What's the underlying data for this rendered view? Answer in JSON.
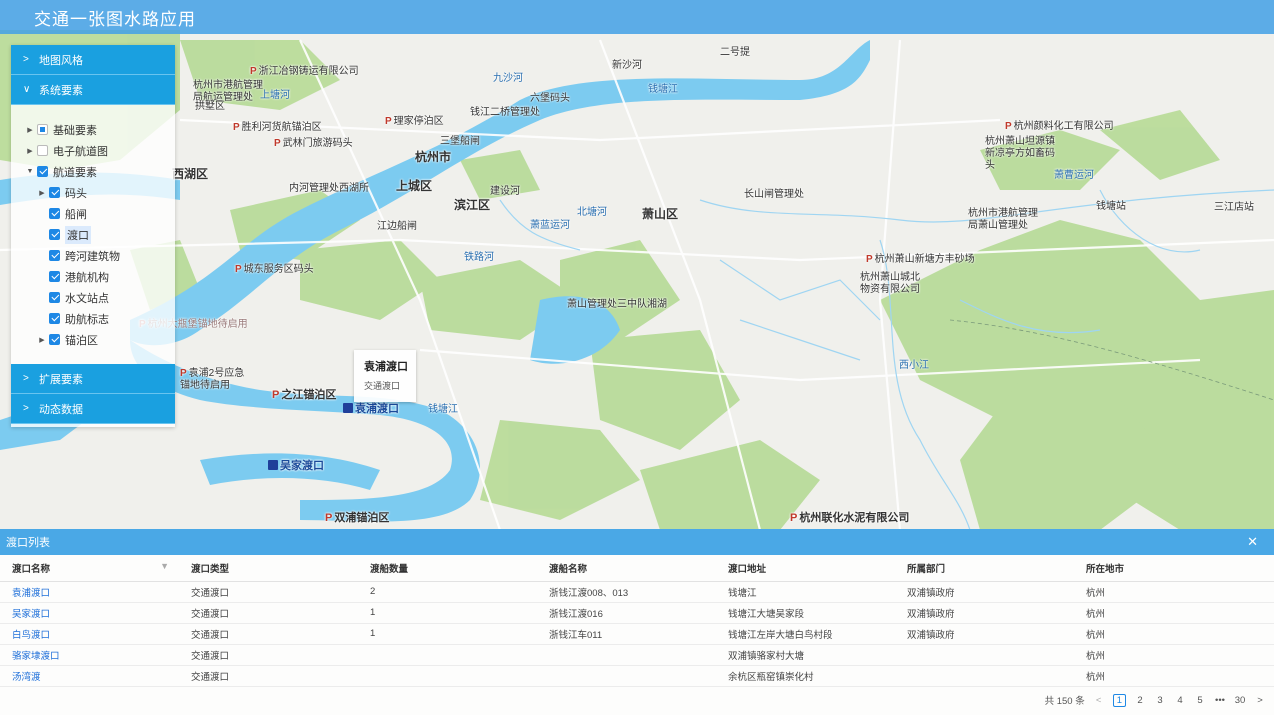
{
  "header": {
    "title": "交通一张图水路应用"
  },
  "panel": {
    "sections": {
      "map_style": "地图风格",
      "system_elements": "系统要素",
      "extended_elements": "扩展要素",
      "dynamic_data": "动态数据"
    },
    "tree": {
      "base": "基础要素",
      "electronic_chart": "电子航道图",
      "channel": "航道要素",
      "wharf": "码头",
      "shiplock": "船闸",
      "ferry": "渡口",
      "bridge": "跨河建筑物",
      "port_agency": "港航机构",
      "hydro_station": "水文站点",
      "nav_marks": "助航标志",
      "anchorage": "锚泊区"
    }
  },
  "popup": {
    "title": "袁浦渡口",
    "subtitle": "交通渡口"
  },
  "map": {
    "labels": [
      "浙江冶钢铸运有限公司",
      "杭州市港航管理局航运管理处",
      "拱墅区",
      "胜利河货航锚泊区",
      "理家停泊区",
      "武林门旅游码头",
      "六堡码头",
      "钱江二桥管理处",
      "三堡船闸",
      "杭州市",
      "内河管理处西湖所",
      "上城区",
      "滨江区",
      "建设河",
      "长山闸管理处",
      "江边船闸",
      "西湖区",
      "城东服务区码头",
      "萧山区",
      "萧山管理处三中队湘湖",
      "杭州萧山新塘方丰砂场",
      "杭州萧山城北物资有限公司",
      "杭州市港航管理局萧山管理处",
      "钱塘站",
      "三江店站",
      "杭州颜料化工有限公司",
      "杭州萧山坦源镇新凉亭方如畜码头",
      "袁浦2号应急锚地待启用",
      "之江锚泊区",
      "袁浦渡口",
      "吴家渡口",
      "双浦锚泊区",
      "杭州联化水泥有限公司",
      "九沙河",
      "钱塘江",
      "上塘河",
      "北塘河",
      "萧蓝运河",
      "铁路河",
      "西小江",
      "萧曹运河",
      "二号提",
      "新沙河",
      "杭州大瓶堡锚地待启用"
    ]
  },
  "list": {
    "title": "渡口列表",
    "columns": [
      "渡口名称",
      "渡口类型",
      "渡船数量",
      "渡船名称",
      "渡口地址",
      "所属部门",
      "所在地市"
    ],
    "rows": [
      [
        "袁浦渡口",
        "交通渡口",
        "2",
        "浙钱江渡008、013",
        "钱塘江",
        "双浦镇政府",
        "杭州"
      ],
      [
        "吴家渡口",
        "交通渡口",
        "1",
        "浙钱江渡016",
        "钱塘江大塘吴家段",
        "双浦镇政府",
        "杭州"
      ],
      [
        "白鸟渡口",
        "交通渡口",
        "1",
        "浙钱江车011",
        "钱塘江左岸大塘白鸟村段",
        "双浦镇政府",
        "杭州"
      ],
      [
        "骆家埭渡口",
        "交通渡口",
        "",
        "",
        "双浦镇骆家村大塘",
        "",
        "杭州"
      ],
      [
        "汤湾渡",
        "交通渡口",
        "",
        "",
        "余杭区瓶窑镇崇化村",
        "",
        "杭州"
      ]
    ],
    "pagination": {
      "total": "共 150 条",
      "pages": [
        "1",
        "2",
        "3",
        "4",
        "5",
        "•••",
        "30"
      ],
      "current": "1"
    }
  },
  "colors": {
    "header": "#42a0e6",
    "panel_head": "#1aa0e0",
    "river": "#6ec5ef",
    "green": "#b9db9a",
    "link": "#1e6fd9"
  }
}
